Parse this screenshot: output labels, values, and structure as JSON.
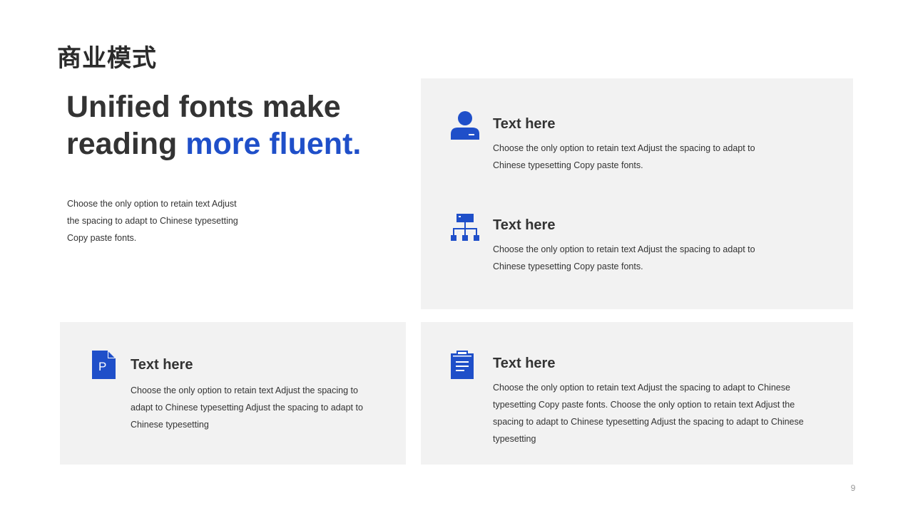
{
  "slide": {
    "title": "商业模式",
    "headline_line1": "Unified fonts make",
    "headline_line2_plain": "reading ",
    "headline_line2_accent": "more fluent.",
    "intro": "Choose the only option to retain text Adjust the spacing to adapt to Chinese typesetting Copy paste fonts.",
    "page_number": "9"
  },
  "features": [
    {
      "icon": "user-icon",
      "title": "Text here",
      "body": "Choose the only option to retain text Adjust the spacing to adapt to Chinese  typesetting Copy paste fonts."
    },
    {
      "icon": "org-chart-icon",
      "title": "Text here",
      "body": "Choose the only option to retain text Adjust the spacing to adapt to Chinese  typesetting Copy paste fonts."
    },
    {
      "icon": "document-p-icon",
      "icon_letter": "P",
      "title": "Text here",
      "body": "Choose the only option to retain text Adjust the spacing to adapt to Chinese  typesetting Adjust the spacing to adapt to Chinese  typesetting"
    },
    {
      "icon": "clipboard-icon",
      "title": "Text here",
      "body": "Choose the only option to retain text Adjust the spacing to adapt to Chinese  typesetting Copy paste fonts. Choose the only option to retain text Adjust the spacing to adapt to Chinese  typesetting Adjust the spacing to adapt to Chinese  typesetting"
    }
  ],
  "colors": {
    "accent": "#1f4fc9",
    "text": "#333333",
    "panel": "#f2f2f2"
  }
}
